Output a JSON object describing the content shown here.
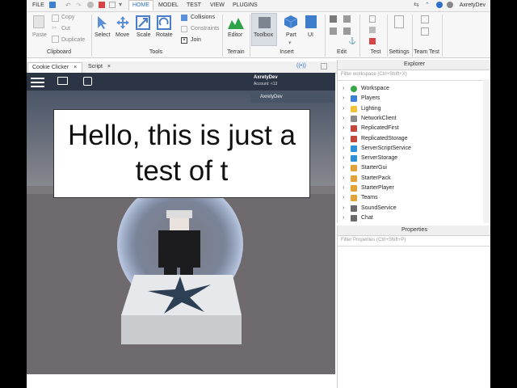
{
  "menubar": {
    "file": "FILE",
    "tabs": [
      "HOME",
      "MODEL",
      "TEST",
      "VIEW",
      "PLUGINS"
    ],
    "active_tab": "HOME",
    "username": "AxretyDev"
  },
  "ribbon": {
    "clipboard": {
      "paste": "Paste",
      "copy": "Copy",
      "cut": "Cut",
      "duplicate": "Duplicate",
      "group": "Clipboard"
    },
    "tools": {
      "select": "Select",
      "move": "Move",
      "scale": "Scale",
      "rotate": "Rotate",
      "collisions": "Collisions",
      "constraints": "Constraints",
      "join": "Join",
      "group": "Tools"
    },
    "terrain": {
      "editor": "Editor",
      "group": "Terrain"
    },
    "insert": {
      "toolbox": "Toolbox",
      "part": "Part",
      "ui": "UI",
      "group": "Insert"
    },
    "edit": {
      "group": "Edit"
    },
    "test": {
      "group": "Test"
    },
    "settings": {
      "group": "Settings"
    },
    "team_test": {
      "group": "Team Test"
    }
  },
  "doc_tabs": [
    {
      "label": "Cookie Clicker",
      "close": "×"
    },
    {
      "label": "Script",
      "close": "×"
    }
  ],
  "game": {
    "account_name": "AxretyDev",
    "account_sub": "Account: <13",
    "player_tag": "AxretyDev",
    "dialog_text": "Hello, this is just a test of t"
  },
  "explorer": {
    "title": "Explorer",
    "filter_placeholder": "Filter workspace (Ctrl+Shift+X)",
    "items": [
      {
        "name": "Workspace",
        "color": "#3aa64a"
      },
      {
        "name": "Players",
        "color": "#3c7fd6"
      },
      {
        "name": "Lighting",
        "color": "#f2c23a"
      },
      {
        "name": "NetworkClient",
        "color": "#8a8a8a"
      },
      {
        "name": "ReplicatedFirst",
        "color": "#c2463b"
      },
      {
        "name": "ReplicatedStorage",
        "color": "#c2463b"
      },
      {
        "name": "ServerScriptService",
        "color": "#2f8fd6"
      },
      {
        "name": "ServerStorage",
        "color": "#2f8fd6"
      },
      {
        "name": "StarterGui",
        "color": "#e0a33a"
      },
      {
        "name": "StarterPack",
        "color": "#e0a33a"
      },
      {
        "name": "StarterPlayer",
        "color": "#e0a33a"
      },
      {
        "name": "Teams",
        "color": "#e0a33a"
      },
      {
        "name": "SoundService",
        "color": "#6a6a6a"
      },
      {
        "name": "Chat",
        "color": "#6a6a6a"
      }
    ]
  },
  "properties": {
    "title": "Properties",
    "filter_placeholder": "Filter Properties (Ctrl+Shift+P)"
  },
  "colors": {
    "accent": "#2f6fc9",
    "viewport_sky": "#4f5d70",
    "baseplate": "#6f6a6e",
    "topbar": "#2b3545"
  }
}
